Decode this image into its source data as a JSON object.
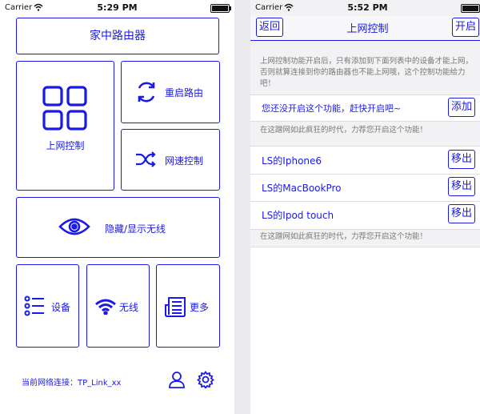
{
  "colors": {
    "accent": "#1a1ae8"
  },
  "status_left": {
    "carrier": "Carrier",
    "time": "5:29 PM"
  },
  "status_right": {
    "carrier": "Carrier",
    "time": "5:52 PM"
  },
  "home": {
    "title": "家中路由器",
    "tiles": {
      "net_control": {
        "label": "上网控制",
        "icon": "grid-icon"
      },
      "reboot": {
        "label": "重启路由",
        "icon": "refresh-icon"
      },
      "speed": {
        "label": "网速控制",
        "icon": "shuffle-icon"
      },
      "wifi_toggle": {
        "label": "隐藏/显示无线",
        "icon": "eye-icon"
      },
      "devices": {
        "label": "设备",
        "icon": "list-icon"
      },
      "wireless": {
        "label": "无线",
        "icon": "wifi-icon"
      },
      "more": {
        "label": "更多",
        "icon": "newspaper-icon"
      }
    },
    "connection": "当前网络连接：TP_Link_xx",
    "user_icon": "user-icon",
    "settings_icon": "gear-icon"
  },
  "control": {
    "back": "返回",
    "title": "上网控制",
    "enable": "开启",
    "description": "上网控制功能开启后，只有添加到下面列表中的设备才能上网，否则就算连接到你的路由器也不能上网哦，这个控制功能给力吧！",
    "prompt": "您还没开启这个功能，赶快开启吧~",
    "add": "添加",
    "hint1": "在这蹭网如此疯狂的时代，力荐您开启这个功能！",
    "devices": [
      {
        "name": "LS的Iphone6",
        "action": "移出"
      },
      {
        "name": "LS的MacBookPro",
        "action": "移出"
      },
      {
        "name": "LS的Ipod touch",
        "action": "移出"
      }
    ],
    "hint2": "在这蹭网如此疯狂的时代，力荐您开启这个功能！"
  }
}
